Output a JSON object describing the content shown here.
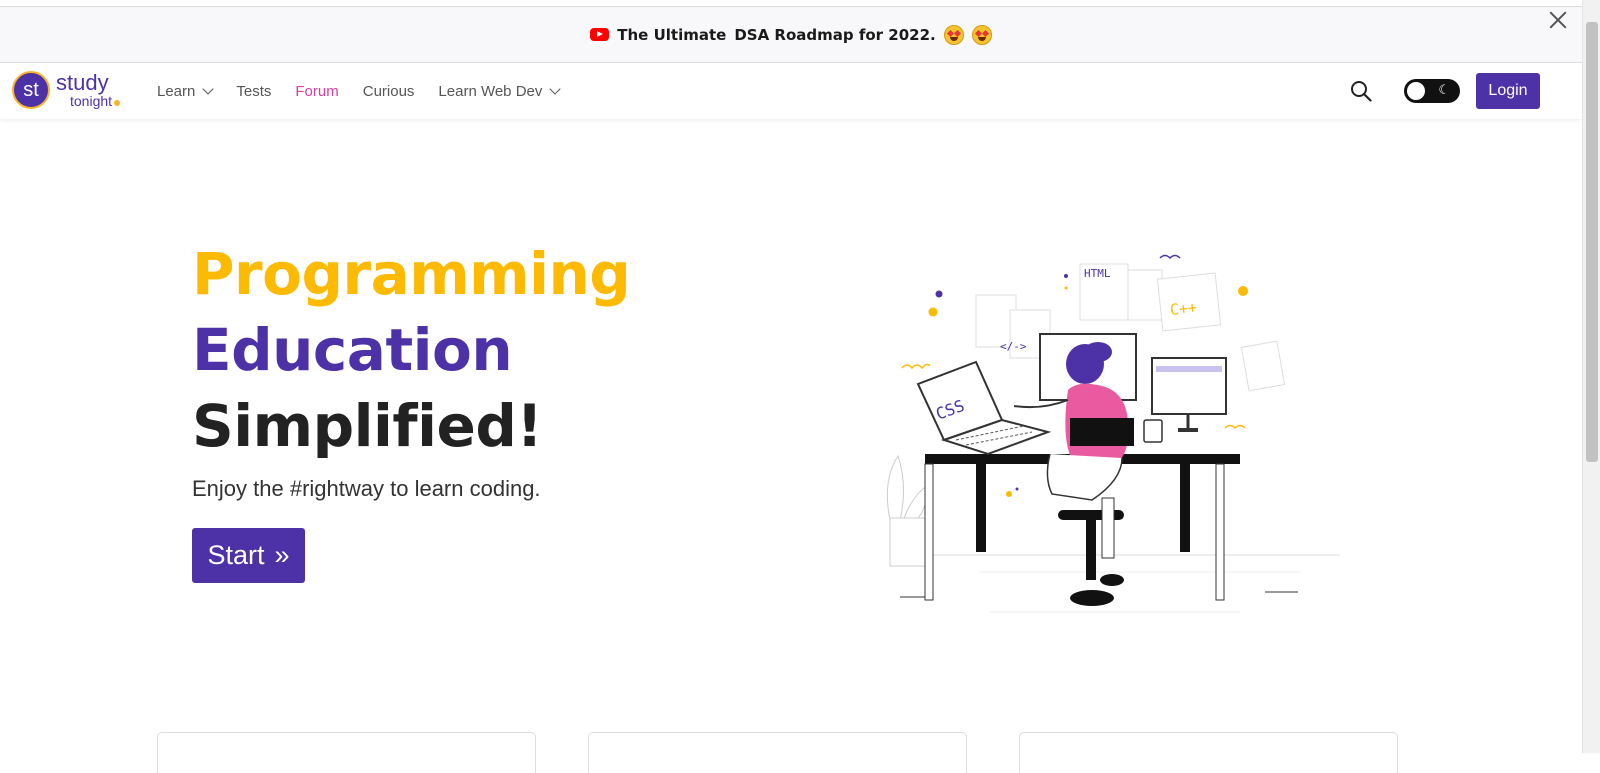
{
  "announcement": {
    "text_prefix": "The Ultimate",
    "text_bold": "DSA Roadmap for 2022."
  },
  "brand": {
    "logo_initials": "st",
    "name_top": "study",
    "name_bottom": "tonight"
  },
  "nav": {
    "items": [
      {
        "label": "Learn",
        "dropdown": true
      },
      {
        "label": "Tests",
        "dropdown": false
      },
      {
        "label": "Forum",
        "dropdown": false,
        "active": true
      },
      {
        "label": "Curious",
        "dropdown": false
      },
      {
        "label": "Learn Web Dev",
        "dropdown": true
      }
    ],
    "login_label": "Login",
    "theme": "light"
  },
  "hero": {
    "line1": "Programming",
    "line2": "Education",
    "line3": "Simplified!",
    "subtitle": "Enjoy the #rightway to learn coding.",
    "start_label": "Start",
    "start_icon": "»"
  },
  "illustration": {
    "labels": [
      "HTML",
      "C++",
      "CSS",
      "</->"
    ]
  },
  "colors": {
    "brand_purple": "#4d31a7",
    "accent_yellow": "#fcba03",
    "forum_pink": "#d6409f",
    "dark_text": "#222222"
  }
}
